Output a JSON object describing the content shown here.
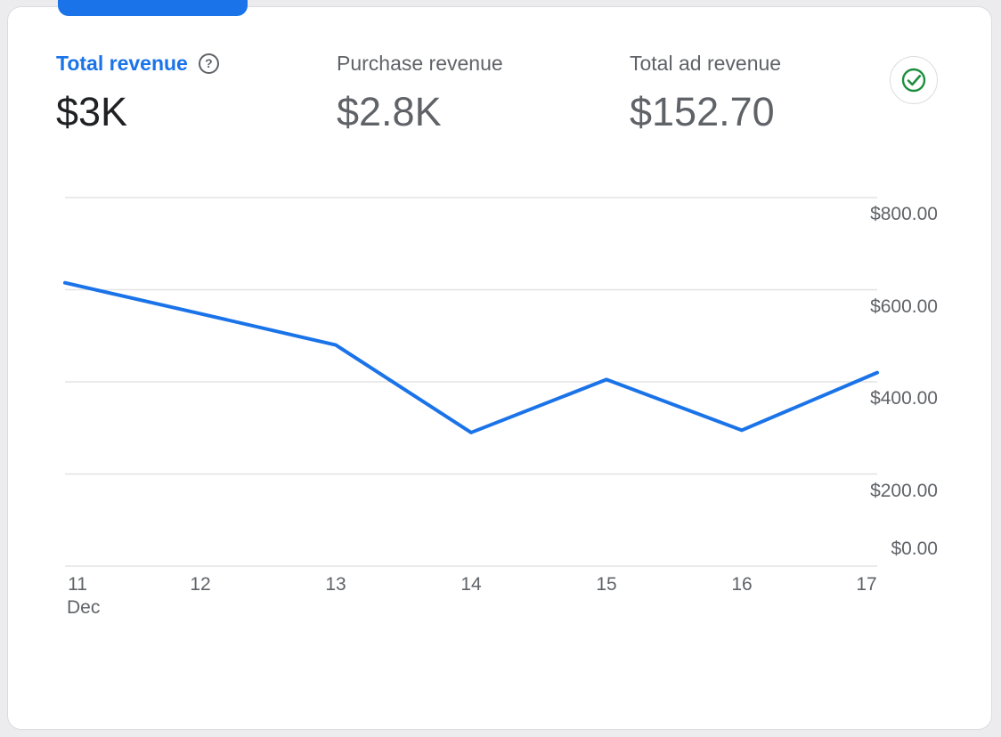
{
  "theme": {
    "accent_blue": "#1a73e8",
    "text_dark": "#202124",
    "text_gray": "#5f6368",
    "grid_gray": "#e3e3e3",
    "success_green": "#1e8e3e",
    "card_bg": "#ffffff"
  },
  "icons": {
    "help_glyph": "?",
    "check_icon": "check-circle"
  },
  "metrics": [
    {
      "label": "Total revenue",
      "value": "$3K",
      "selected": true
    },
    {
      "label": "Purchase revenue",
      "value": "$2.8K",
      "selected": false
    },
    {
      "label": "Total ad revenue",
      "value": "$152.70",
      "selected": false
    }
  ],
  "chart_data": {
    "type": "line",
    "series_name": "Total revenue",
    "x_labels": [
      "11",
      "12",
      "13",
      "14",
      "15",
      "16",
      "17"
    ],
    "x_sub_label": "Dec",
    "values": [
      615,
      548,
      480,
      290,
      405,
      295,
      420
    ],
    "y_ticks": [
      "$800.00",
      "$600.00",
      "$400.00",
      "$200.00",
      "$0.00"
    ],
    "ylim": [
      0,
      800
    ],
    "line_color": "#1a73e8",
    "grid": true,
    "legend": false,
    "y_axis_position": "right"
  }
}
